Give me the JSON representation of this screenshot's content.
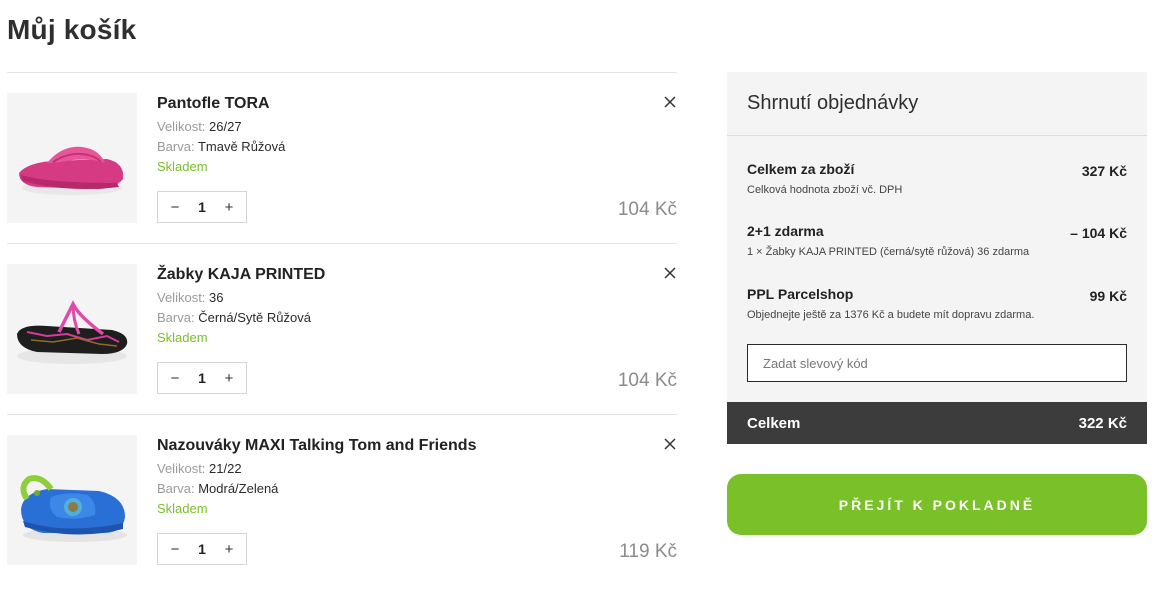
{
  "page": {
    "title": "Můj košík"
  },
  "cart": {
    "size_label": "Velikost:",
    "color_label": "Barva:",
    "items": [
      {
        "name": "Pantofle TORA",
        "size": "26/27",
        "color": "Tmavě Růžová",
        "stock": "Skladem",
        "qty": "1",
        "price": "104 Kč",
        "image_icon": "pink-slide-sandal"
      },
      {
        "name": "Žabky KAJA PRINTED",
        "size": "36",
        "color": "Černá/Sytě Růžová",
        "stock": "Skladem",
        "qty": "1",
        "price": "104 Kč",
        "image_icon": "black-flip-flop"
      },
      {
        "name": "Nazouváky MAXI Talking Tom and Friends",
        "size": "21/22",
        "color": "Modrá/Zelená",
        "stock": "Skladem",
        "qty": "1",
        "price": "119 Kč",
        "image_icon": "blue-clog"
      }
    ],
    "qty_minus": "−",
    "qty_plus": "+",
    "remove_icon": "close-icon"
  },
  "summary": {
    "title": "Shrnutí objednávky",
    "goods_label": "Celkem za zboží",
    "goods_value": "327 Kč",
    "goods_note": "Celková hodnota zboží vč. DPH",
    "promo_label": "2+1 zdarma",
    "promo_value": "– 104 Kč",
    "promo_note": "1 × Žabky KAJA PRINTED (černá/sytě růžová) 36 zdarma",
    "shipping_label": "PPL Parcelshop",
    "shipping_value": "99 Kč",
    "shipping_note": "Objednejte ještě za 1376 Kč a budete mít dopravu zdarma.",
    "coupon_placeholder": "Zadat slevový kód",
    "total_label": "Celkem",
    "total_value": "322 Kč"
  },
  "checkout": {
    "label": "PŘEJÍT K POKLADNĚ"
  },
  "colors": {
    "accent": "#7ac029",
    "total_bar": "#3c3c3c",
    "summary_bg": "#f4f4f4"
  }
}
